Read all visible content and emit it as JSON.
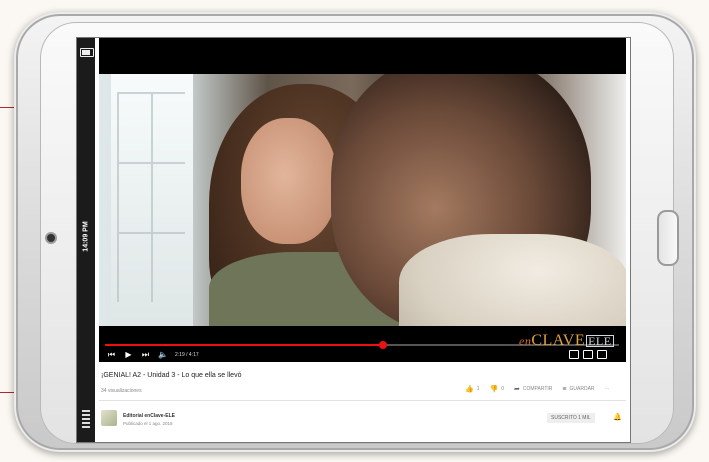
{
  "status_bar": {
    "clock": "14:09 PM"
  },
  "player": {
    "current_time": "2:19 / 4:17",
    "progress": 0.54,
    "brand": {
      "en": "en",
      "clave": "CLAVE",
      "ele": "ELE"
    }
  },
  "video": {
    "title": "¡GENIAL! A2 - Unidad 3 - Lo que ella se llevó",
    "views": "34 visualizaciones",
    "likes": "1",
    "dislikes": "0",
    "share_label": "COMPARTIR",
    "save_label": "GUARDAR",
    "more_label": "···"
  },
  "channel": {
    "name": "Editorial enClave-ELE",
    "published": "Publicado el 1 ago. 2018",
    "subscribe_label": "SUSCRITO",
    "subscriber_count": "1 MIL"
  },
  "colors": {
    "accent": "#b3282d",
    "progress": "#ee1111"
  }
}
